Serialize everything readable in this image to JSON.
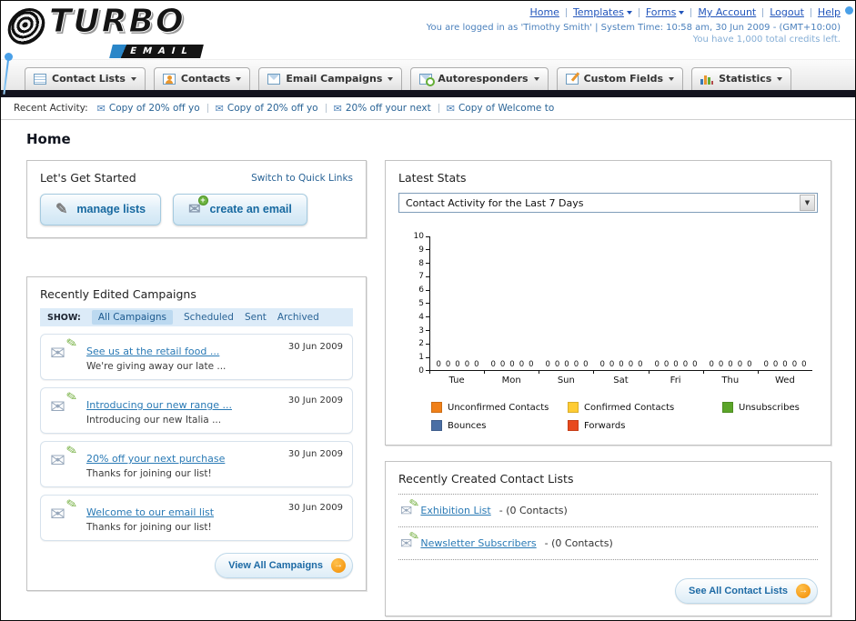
{
  "icons": {
    "envelope": "✉",
    "pencil": "✎",
    "plus": "+",
    "arrow": "→",
    "caret": "▼"
  },
  "header": {
    "logo_title": "TURBO",
    "logo_subtitle": "EMAIL",
    "nav": [
      "Home",
      "Templates",
      "Forms",
      "My Account",
      "Logout",
      "Help"
    ],
    "login_info": "You are logged in as 'Timothy Smith' | System Time: 10:58 am, 30 Jun 2009 - (GMT+10:00)",
    "credits": "You have 1,000 total credits left."
  },
  "tabs": [
    {
      "label": "Contact Lists"
    },
    {
      "label": "Contacts"
    },
    {
      "label": "Email Campaigns"
    },
    {
      "label": "Autoresponders"
    },
    {
      "label": "Custom Fields"
    },
    {
      "label": "Statistics"
    }
  ],
  "recent_activity": {
    "label": "Recent Activity:",
    "items": [
      "Copy of 20% off yo",
      "Copy of 20% off yo",
      "20% off your next",
      "Copy of Welcome to"
    ]
  },
  "page_title": "Home",
  "get_started": {
    "title": "Let's Get Started",
    "switch_link": "Switch to Quick Links",
    "manage_lists_label": "manage lists",
    "create_email_label": "create an email"
  },
  "campaigns": {
    "title": "Recently Edited Campaigns",
    "show_label": "SHOW:",
    "filters": [
      "All Campaigns",
      "Scheduled",
      "Sent",
      "Archived"
    ],
    "items": [
      {
        "title": "See us at the retail food ...",
        "subtitle": "We're giving away our late ...",
        "date": "30 Jun 2009"
      },
      {
        "title": "Introducing our new range ...",
        "subtitle": "Introducing our new Italia ...",
        "date": "30 Jun 2009"
      },
      {
        "title": "20% off your next purchase",
        "subtitle": "Thanks for joining our list!",
        "date": "30 Jun 2009"
      },
      {
        "title": "Welcome to our email list",
        "subtitle": "Thanks for joining our list!",
        "date": "30 Jun 2009"
      }
    ],
    "view_all_label": "View All Campaigns"
  },
  "stats": {
    "title": "Latest Stats",
    "dropdown_value": "Contact Activity for the Last 7 Days",
    "chart_data": {
      "type": "bar",
      "categories": [
        "Tue",
        "Mon",
        "Sun",
        "Sat",
        "Fri",
        "Thu",
        "Wed"
      ],
      "series": [
        {
          "name": "Unconfirmed Contacts",
          "color": "#f08019",
          "values": [
            0,
            0,
            0,
            0,
            0,
            0,
            0
          ]
        },
        {
          "name": "Confirmed Contacts",
          "color": "#ffcc33",
          "values": [
            0,
            0,
            0,
            0,
            0,
            0,
            0
          ]
        },
        {
          "name": "Unsubscribes",
          "color": "#5ba529",
          "values": [
            0,
            0,
            0,
            0,
            0,
            0,
            0
          ]
        },
        {
          "name": "Bounces",
          "color": "#4a6fa5",
          "values": [
            0,
            0,
            0,
            0,
            0,
            0,
            0
          ]
        },
        {
          "name": "Forwards",
          "color": "#e8491d",
          "values": [
            0,
            0,
            0,
            0,
            0,
            0,
            0
          ]
        }
      ],
      "ylim": [
        0,
        10
      ],
      "grid": false,
      "legend_position": "bottom"
    }
  },
  "contact_lists": {
    "title": "Recently Created Contact Lists",
    "items": [
      {
        "name": "Exhibition List",
        "detail": "- (0 Contacts)"
      },
      {
        "name": "Newsletter Subscribers",
        "detail": "- (0 Contacts)"
      }
    ],
    "see_all_label": "See All Contact Lists"
  }
}
